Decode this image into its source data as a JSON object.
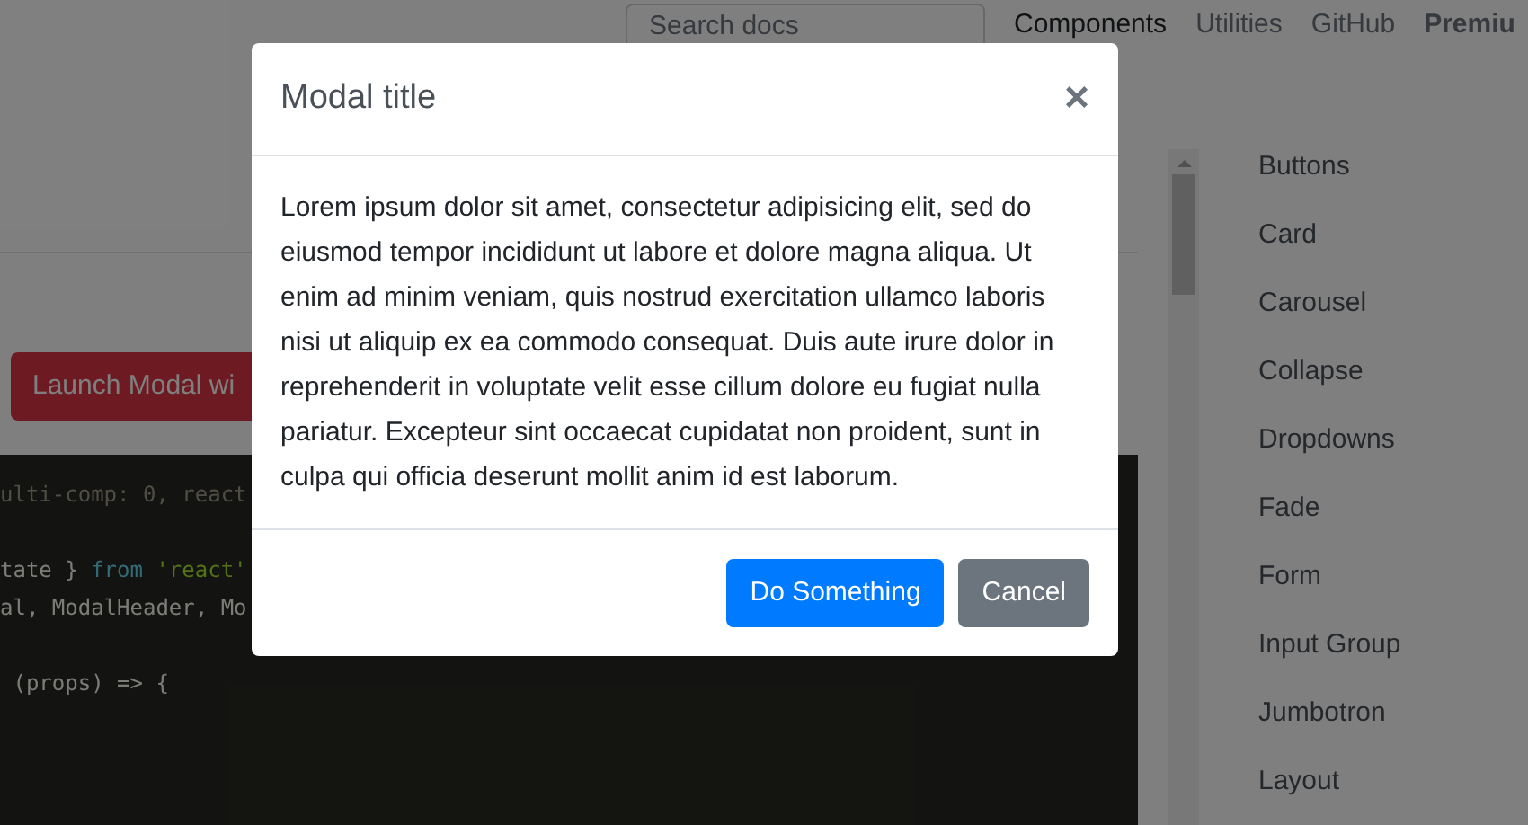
{
  "navbar": {
    "search": {
      "placeholder": "Search docs"
    },
    "links": [
      {
        "label": "Components",
        "selected": true,
        "bold": false
      },
      {
        "label": "Utilities",
        "selected": false,
        "bold": false
      },
      {
        "label": "GitHub",
        "selected": false,
        "bold": false
      },
      {
        "label": "Premiu",
        "selected": false,
        "bold": true
      }
    ]
  },
  "launch_button": {
    "label": "Launch Modal wi"
  },
  "code": [
    {
      "blank_before": false,
      "tokens": [
        {
          "kind": "comment",
          "text": "ulti-comp: 0, react"
        }
      ]
    },
    {
      "blank_before": true,
      "tokens": [
        {
          "kind": "plain",
          "text": "tate } "
        },
        {
          "kind": "keyword",
          "text": "from"
        },
        {
          "kind": "string",
          "text": " 'react'"
        }
      ]
    },
    {
      "blank_before": false,
      "tokens": [
        {
          "kind": "plain",
          "text": "al, ModalHeader, Mo"
        }
      ]
    },
    {
      "blank_before": true,
      "tokens": [
        {
          "kind": "plain",
          "text": " (props) => {"
        }
      ]
    }
  ],
  "sidebar": {
    "items": [
      "Buttons",
      "Card",
      "Carousel",
      "Collapse",
      "Dropdowns",
      "Fade",
      "Form",
      "Input Group",
      "Jumbotron",
      "Layout"
    ]
  },
  "modal": {
    "title": "Modal title",
    "close": "×",
    "body": "Lorem ipsum dolor sit amet, consectetur adipisicing elit, sed do eiusmod tempor incididunt ut labore et dolore magna aliqua. Ut enim ad minim veniam, quis nostrud exercitation ullamco laboris nisi ut aliquip ex ea commodo consequat. Duis aute irure dolor in reprehenderit in voluptate velit esse cillum dolore eu fugiat nulla pariatur. Excepteur sint occaecat cupidatat non proident, sunt in culpa qui officia deserunt mollit anim id est laborum.",
    "buttons": [
      {
        "kind": "primary",
        "label": "Do Something"
      },
      {
        "kind": "secondary",
        "label": "Cancel"
      }
    ]
  }
}
